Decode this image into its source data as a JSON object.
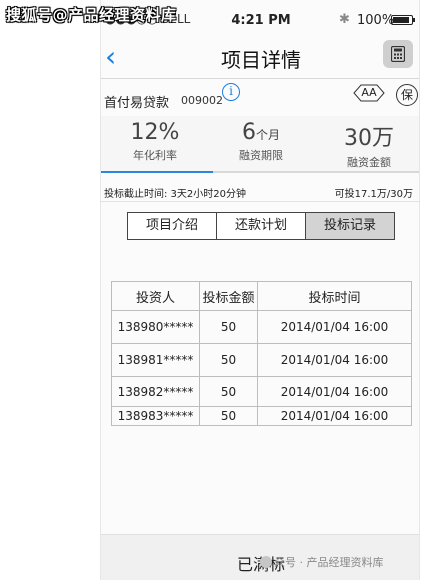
{
  "watermark": {
    "top": "搜狐号@产品经理资料库",
    "bottom": "众号 · 产品经理资料库"
  },
  "status_bar": {
    "carrier": "●●●○○ BELL",
    "time": "4:21 PM",
    "bluetooth": "✱",
    "battery": "100%"
  },
  "nav": {
    "back_icon": "‹",
    "title": "项目详情",
    "calculator_icon": "calculator-icon"
  },
  "product": {
    "name": "首付易贷款",
    "code": "009002",
    "info_icon": "i",
    "font_size_toggle": "AA",
    "guarantee_badge": "保"
  },
  "stats": [
    {
      "value": "12%",
      "unit": "",
      "label": "年化利率"
    },
    {
      "value": "6",
      "unit": "个月",
      "label": "融资期限"
    },
    {
      "value": "30万",
      "unit": "",
      "label": "融资金额"
    }
  ],
  "progress": {
    "percent": 35
  },
  "deadline": {
    "left": "投标截止时间: 3天2小时20分钟",
    "right": "可投17.1万/30万"
  },
  "tabs": [
    {
      "label": "项目介绍",
      "active": false
    },
    {
      "label": "还款计划",
      "active": false
    },
    {
      "label": "投标记录",
      "active": true
    }
  ],
  "records_table": {
    "headers": [
      "投资人",
      "投标金额",
      "投标时间"
    ],
    "rows": [
      [
        "138980*****",
        "50",
        "2014/01/04 16:00"
      ],
      [
        "138981*****",
        "50",
        "2014/01/04 16:00"
      ],
      [
        "138982*****",
        "50",
        "2014/01/04 16:00"
      ],
      [
        "138983*****",
        "50",
        "2014/01/04 16:00"
      ]
    ]
  },
  "footer": {
    "status_label": "已满标"
  }
}
